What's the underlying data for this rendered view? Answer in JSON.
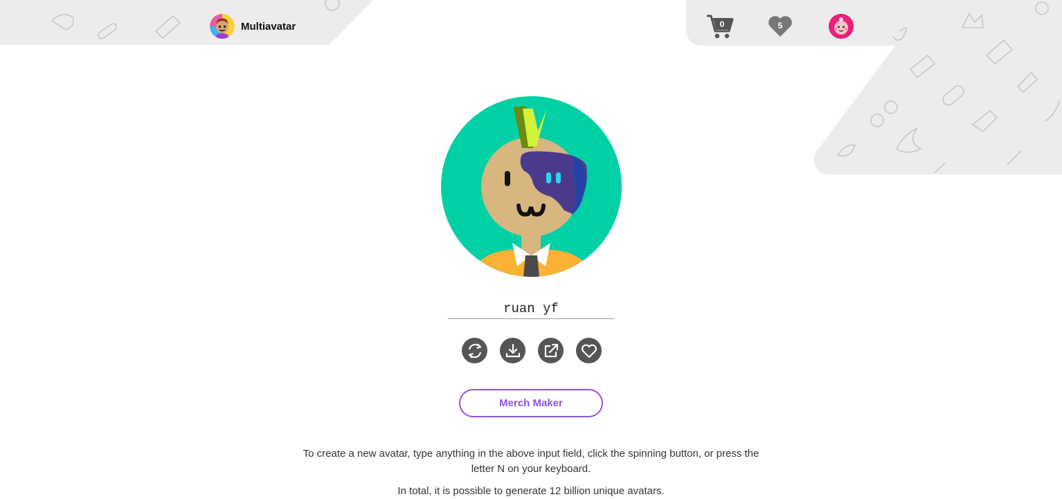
{
  "header": {
    "brand": "Multiavatar",
    "cart_count": "0",
    "favorites_count": "5"
  },
  "main": {
    "avatar_name": "ruan yf",
    "actions": [
      {
        "name": "refresh",
        "icon": "refresh-icon"
      },
      {
        "name": "download",
        "icon": "download-icon"
      },
      {
        "name": "share",
        "icon": "external-link-icon"
      },
      {
        "name": "favorite",
        "icon": "heart-icon"
      }
    ],
    "merch_button": "Merch Maker",
    "description": "To create a new avatar, type anything in the above input field, click the spinning button, or press the letter N on your keyboard.",
    "description2": "In total, it is possible to generate 12 billion unique avatars."
  },
  "colors": {
    "accent": "#8e55d6",
    "avatar_bg": "#00d0a4",
    "icon_dark": "#555555",
    "header_bg": "#ececec"
  }
}
